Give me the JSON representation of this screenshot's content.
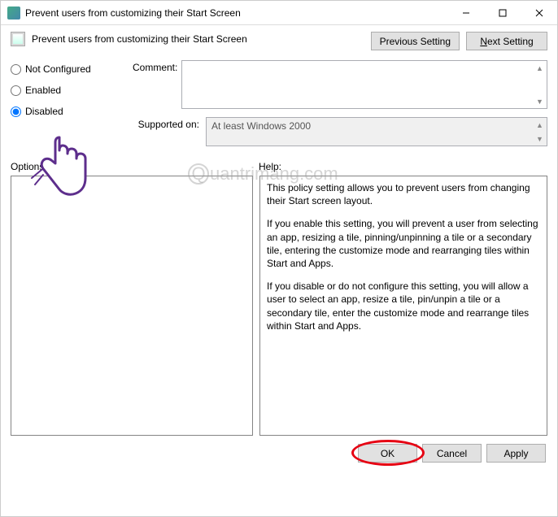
{
  "window": {
    "title": "Prevent users from customizing their Start Screen"
  },
  "header": {
    "policy_title": "Prevent users from customizing their Start Screen",
    "previous": "Previous Setting",
    "next_prefix": "N",
    "next_rest": "ext Setting"
  },
  "radios": {
    "not_configured": "Not Configured",
    "enabled": "Enabled",
    "disabled": "Disabled",
    "selected": "disabled"
  },
  "fields": {
    "comment_label": "Comment:",
    "comment_value": "",
    "supported_label": "Supported on:",
    "supported_value": "At least Windows 2000"
  },
  "sections": {
    "options_label": "Options:",
    "help_label": "Help:"
  },
  "help": {
    "p1": "This policy setting allows you to prevent users from changing their Start screen layout.",
    "p2": "If you enable this setting, you will prevent a user from selecting an app, resizing a tile, pinning/unpinning a tile or a secondary tile, entering the customize mode and rearranging tiles within Start and Apps.",
    "p3": "If you disable or do not configure this setting, you will allow a user to select an app, resize a tile, pin/unpin a tile or a secondary tile, enter the customize mode and rearrange tiles within Start and Apps."
  },
  "buttons": {
    "ok": "OK",
    "cancel": "Cancel",
    "apply": "Apply"
  },
  "watermark": {
    "pre": "Q",
    "rest": "uantrimang.com"
  }
}
